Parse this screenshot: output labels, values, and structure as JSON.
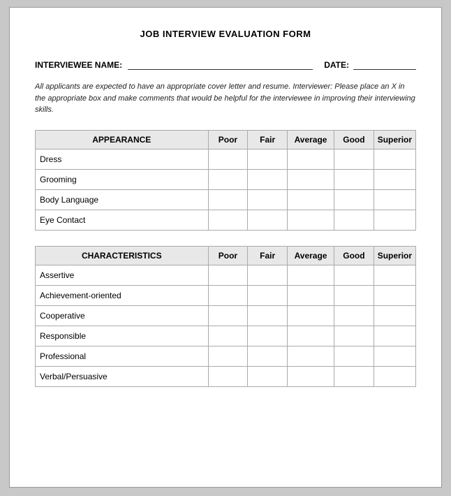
{
  "form": {
    "title": "JOB INTERVIEW EVALUATION FORM",
    "interviewee_label": "INTERVIEWEE NAME:",
    "date_label": "DATE:",
    "instructions": "All applicants are expected to have an appropriate cover letter and resume. Interviewer: Please place an X in the appropriate box and make comments that would be helpful for the interviewee in improving their interviewing skills.",
    "appearance_table": {
      "header": "APPEARANCE",
      "columns": [
        "Poor",
        "Fair",
        "Average",
        "Good",
        "Superior"
      ],
      "rows": [
        "Dress",
        "Grooming",
        "Body Language",
        "Eye Contact"
      ]
    },
    "characteristics_table": {
      "header": "CHARACTERISTICS",
      "columns": [
        "Poor",
        "Fair",
        "Average",
        "Good",
        "Superior"
      ],
      "rows": [
        "Assertive",
        "Achievement-oriented",
        "Cooperative",
        "Responsible",
        "Professional",
        "Verbal/Persuasive"
      ]
    }
  }
}
